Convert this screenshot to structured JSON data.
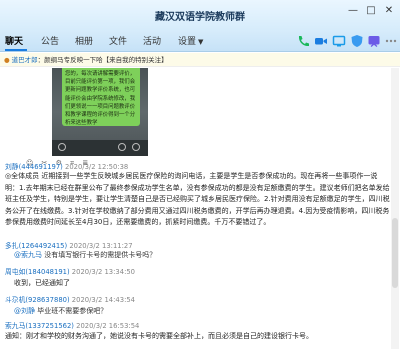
{
  "window": {
    "title": "藏汉双语学院教师群",
    "minimize_icon": "minimize-icon",
    "maximize_icon": "maximize-icon",
    "close_icon": "close-icon"
  },
  "tabs": [
    {
      "label": "聊天",
      "active": true
    },
    {
      "label": "公告"
    },
    {
      "label": "相册"
    },
    {
      "label": "文件"
    },
    {
      "label": "活动"
    },
    {
      "label": "设置"
    }
  ],
  "toolbar_icons": [
    "phone-icon",
    "video-icon",
    "screen-share-icon",
    "shield-icon",
    "whiteboard-icon",
    "more-icon"
  ],
  "toolbar_colors": [
    "#1ab85b",
    "#1a7de0",
    "#1a9be8",
    "#3a9bf0",
    "#6c5ce7",
    "#888888"
  ],
  "notice": {
    "pin_icon": "pin-icon",
    "name": "道巴才郎",
    "text": "：颜纲马专反映一下哈【来自我的特别关注】"
  },
  "phone_screenshot": {
    "bubble_text": "您的，每次请讲解需要评价，目前只能评价第一项，我们会更新问题教学评价系统，也可能评价会由学院系统修改，我们更领说一一项目问题教评价和教学课程的评价得到一个分析来这些教学"
  },
  "reactions": [
    "☺",
    "✂",
    "⚙",
    "⌗",
    "≣"
  ],
  "messages": [
    {
      "sender": "刘静(44469119​7)",
      "time": "2020/3/2 12:50:38",
      "body": "◎全体成员 近期接到一些学生反映城乡居民医疗保险的询问电话，主要是学生是否参保成功的。现在再将一些事项作一说明：1.去年期末已经在群里公布了最终参保成功学生名单，没有参保成功的都是没有足额缴费的学生。建议老师们把名单发给班主任及学生，特别是学生，要让学生清楚自己是否已经购买了城乡居民医疗保险。2.针对费用没有足额缴足的学生，四川税务公开了在线缴费。3.针对在学校缴纳了部分费用又通过四川税务缴费的，开学后再办理退费。4.因为受疫情影响，四川税务参保费用缴费时间延长至4月30日，还需要缴费的，抓紧时间缴费。千万不要错过了。"
    },
    {
      "sender": "多扎(126449241​5)",
      "time": "2020/3/2 13:11:27",
      "quote_name": "@索九马",
      "quote_text": " 没有填写银行卡号的需提供卡号吗？"
    },
    {
      "sender": "周屯如(18404819​1)",
      "time": "2020/3/2 13:34:50",
      "line": "收到，已经通知了"
    },
    {
      "sender": "斗尕机(92863788​0)",
      "time": "2020/3/2 14:43:54",
      "quote_name": "@刘静",
      "quote_text": " 毕业班不需要参保吧？"
    },
    {
      "sender": "索九马(133725156​2)",
      "time": "2020/3/2 16:53:54",
      "body": "通知：刚才和学校的财务沟通了，她说没有卡号的需要全部补上，而且必须是自己的建设银行卡号。"
    }
  ]
}
